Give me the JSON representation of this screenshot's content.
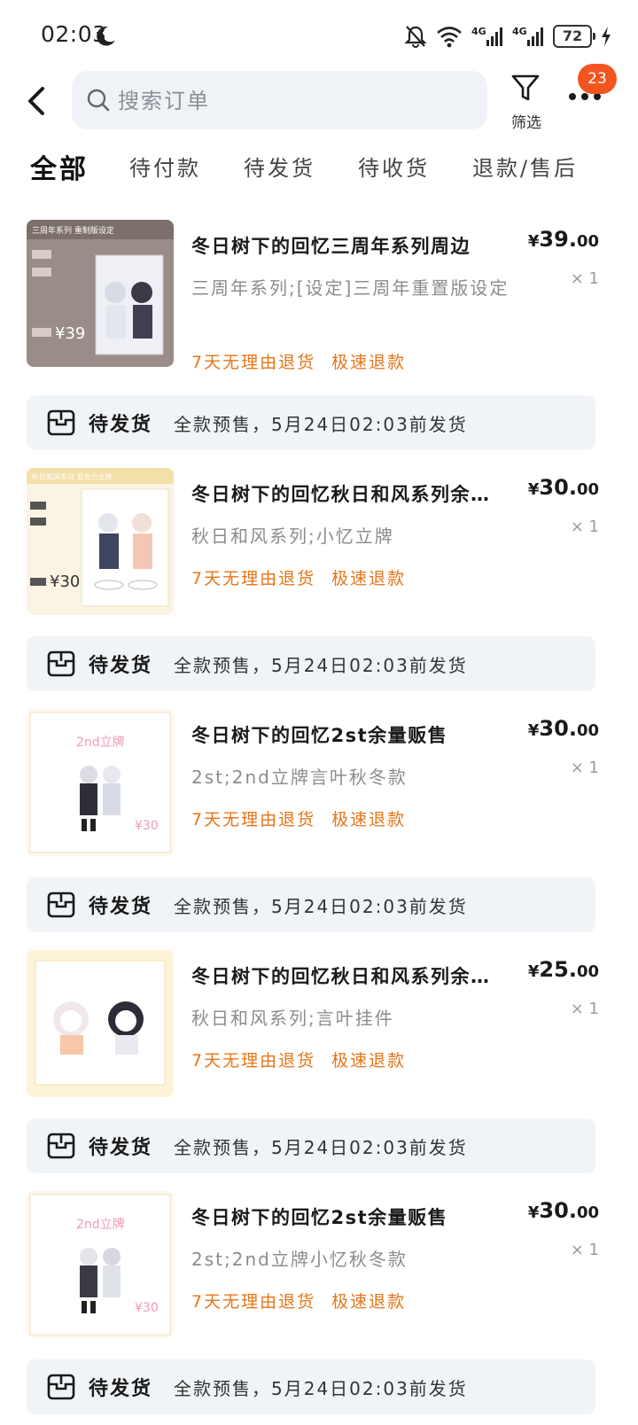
{
  "status_bar": {
    "time": "02:03",
    "battery": "72",
    "network_1": "4G",
    "network_2": "4G"
  },
  "header": {
    "search_placeholder": "搜索订单",
    "filter_label": "筛选",
    "more_badge": "23"
  },
  "tabs": [
    "全部",
    "待付款",
    "待发货",
    "待收货",
    "退款/售后"
  ],
  "colors": {
    "accent_orange": "#e6751a",
    "badge": "#f2551f",
    "ship_bar_bg": "#f1f4f7"
  },
  "orders": [
    {
      "title": "冬日树下的回忆三周年系列周边",
      "spec": "三周年系列;[设定]三周年重置版设定",
      "tag_1": "7天无理由退货",
      "tag_2": "极速退款",
      "price_int": "39.",
      "price_dec": "00",
      "currency": "¥",
      "qty": "× 1",
      "thumb_caption": "三周年系列 重制版设定",
      "thumb_price": "¥39",
      "shipping": {
        "status": "待发货",
        "note": "全款预售，5月24日02:03前发货"
      }
    },
    {
      "title": "冬日树下的回忆秋日和风系列余…",
      "spec": "秋日和风系列;小忆立牌",
      "tag_1": "7天无理由退货",
      "tag_2": "极速退款",
      "price_int": "30.",
      "price_dec": "00",
      "currency": "¥",
      "qty": "× 1",
      "thumb_caption": "秋日和风系列 亚克力立牌",
      "thumb_price": "¥30",
      "shipping": {
        "status": "待发货",
        "note": "全款预售，5月24日02:03前发货"
      }
    },
    {
      "title": "冬日树下的回忆2st余量贩售",
      "spec": "2st;2nd立牌言叶秋冬款",
      "tag_1": "7天无理由退货",
      "tag_2": "极速退款",
      "price_int": "30.",
      "price_dec": "00",
      "currency": "¥",
      "qty": "× 1",
      "thumb_caption": "2nd立牌",
      "thumb_price": "¥30",
      "shipping": {
        "status": "待发货",
        "note": "全款预售，5月24日02:03前发货"
      }
    },
    {
      "title": "冬日树下的回忆秋日和风系列余…",
      "spec": "秋日和风系列;言叶挂件",
      "tag_1": "7天无理由退货",
      "tag_2": "极速退款",
      "price_int": "25.",
      "price_dec": "00",
      "currency": "¥",
      "qty": "× 1",
      "thumb_caption": "",
      "thumb_price": "",
      "shipping": {
        "status": "待发货",
        "note": "全款预售，5月24日02:03前发货"
      }
    },
    {
      "title": "冬日树下的回忆2st余量贩售",
      "spec": "2st;2nd立牌小忆秋冬款",
      "tag_1": "7天无理由退货",
      "tag_2": "极速退款",
      "price_int": "30.",
      "price_dec": "00",
      "currency": "¥",
      "qty": "× 1",
      "thumb_caption": "2nd立牌",
      "thumb_price": "¥30",
      "shipping": {
        "status": "待发货",
        "note": "全款预售，5月24日02:03前发货"
      }
    }
  ]
}
